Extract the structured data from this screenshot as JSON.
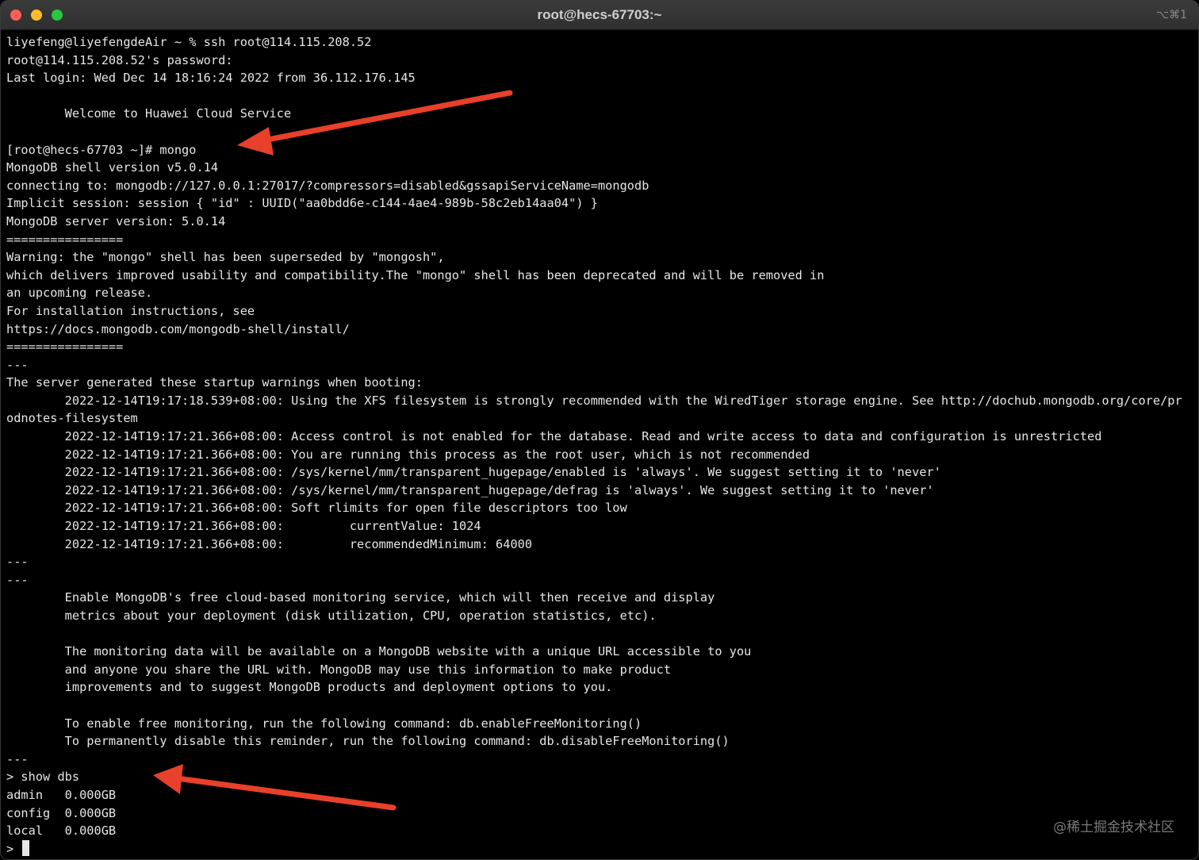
{
  "window": {
    "title": "root@hecs-67703:~",
    "shortcut": "⌥⌘1"
  },
  "terminal": {
    "lines": [
      "liyefeng@liyefengdeAir ~ % ssh root@114.115.208.52",
      "root@114.115.208.52's password:",
      "Last login: Wed Dec 14 18:16:24 2022 from 36.112.176.145",
      "",
      "        Welcome to Huawei Cloud Service",
      "",
      "[root@hecs-67703 ~]# mongo",
      "MongoDB shell version v5.0.14",
      "connecting to: mongodb://127.0.0.1:27017/?compressors=disabled&gssapiServiceName=mongodb",
      "Implicit session: session { \"id\" : UUID(\"aa0bdd6e-c144-4ae4-989b-58c2eb14aa04\") }",
      "MongoDB server version: 5.0.14",
      "================",
      "Warning: the \"mongo\" shell has been superseded by \"mongosh\",",
      "which delivers improved usability and compatibility.The \"mongo\" shell has been deprecated and will be removed in",
      "an upcoming release.",
      "For installation instructions, see",
      "https://docs.mongodb.com/mongodb-shell/install/",
      "================",
      "---",
      "The server generated these startup warnings when booting:",
      "        2022-12-14T19:17:18.539+08:00: Using the XFS filesystem is strongly recommended with the WiredTiger storage engine. See http://dochub.mongodb.org/core/pr",
      "odnotes-filesystem",
      "        2022-12-14T19:17:21.366+08:00: Access control is not enabled for the database. Read and write access to data and configuration is unrestricted",
      "        2022-12-14T19:17:21.366+08:00: You are running this process as the root user, which is not recommended",
      "        2022-12-14T19:17:21.366+08:00: /sys/kernel/mm/transparent_hugepage/enabled is 'always'. We suggest setting it to 'never'",
      "        2022-12-14T19:17:21.366+08:00: /sys/kernel/mm/transparent_hugepage/defrag is 'always'. We suggest setting it to 'never'",
      "        2022-12-14T19:17:21.366+08:00: Soft rlimits for open file descriptors too low",
      "        2022-12-14T19:17:21.366+08:00:         currentValue: 1024",
      "        2022-12-14T19:17:21.366+08:00:         recommendedMinimum: 64000",
      "---",
      "---",
      "        Enable MongoDB's free cloud-based monitoring service, which will then receive and display",
      "        metrics about your deployment (disk utilization, CPU, operation statistics, etc).",
      "",
      "        The monitoring data will be available on a MongoDB website with a unique URL accessible to you",
      "        and anyone you share the URL with. MongoDB may use this information to make product",
      "        improvements and to suggest MongoDB products and deployment options to you.",
      "",
      "        To enable free monitoring, run the following command: db.enableFreeMonitoring()",
      "        To permanently disable this reminder, run the following command: db.disableFreeMonitoring()",
      "---",
      "> show dbs",
      "admin   0.000GB",
      "config  0.000GB",
      "local   0.000GB"
    ],
    "prompt": "> "
  },
  "colors": {
    "background": "#000000",
    "text": "#e6e6e6",
    "arrow": "#e8402a"
  },
  "watermark": "@稀土掘金技术社区"
}
